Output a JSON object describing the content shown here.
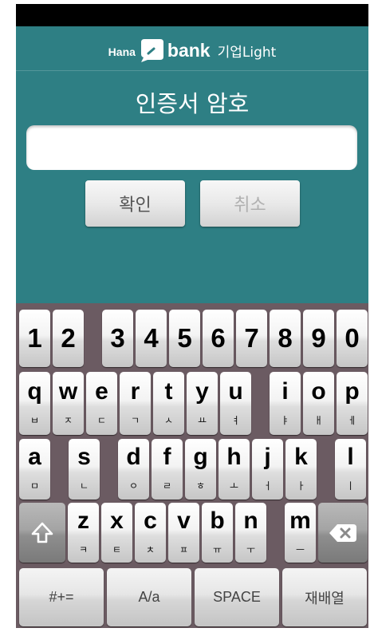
{
  "header": {
    "brand_left": "Hana",
    "logo_icon": "hana-logo-icon",
    "brand_main": "bank",
    "brand_suffix": "기업Light"
  },
  "title": "인증서 암호",
  "password_input": {
    "value": ""
  },
  "buttons": {
    "confirm": "확인",
    "cancel": "취소"
  },
  "keyboard": {
    "numbers": [
      "1",
      "2",
      "3",
      "4",
      "5",
      "6",
      "7",
      "8",
      "9",
      "0"
    ],
    "row_qwerty": [
      {
        "key": "q",
        "sub": "ㅂ"
      },
      {
        "key": "w",
        "sub": "ㅈ"
      },
      {
        "key": "e",
        "sub": "ㄷ"
      },
      {
        "key": "r",
        "sub": "ㄱ"
      },
      {
        "key": "t",
        "sub": "ㅅ"
      },
      {
        "key": "y",
        "sub": "ㅛ"
      },
      {
        "key": "u",
        "sub": "ㅕ"
      },
      {
        "key": "i",
        "sub": "ㅑ"
      },
      {
        "key": "o",
        "sub": "ㅐ"
      },
      {
        "key": "p",
        "sub": "ㅔ"
      }
    ],
    "row_asdf": [
      {
        "key": "a",
        "sub": "ㅁ"
      },
      {
        "key": "s",
        "sub": "ㄴ"
      },
      {
        "key": "d",
        "sub": "ㅇ"
      },
      {
        "key": "f",
        "sub": "ㄹ"
      },
      {
        "key": "g",
        "sub": "ㅎ"
      },
      {
        "key": "h",
        "sub": "ㅗ"
      },
      {
        "key": "j",
        "sub": "ㅓ"
      },
      {
        "key": "k",
        "sub": "ㅏ"
      },
      {
        "key": "l",
        "sub": "ㅣ"
      }
    ],
    "row_zxcv": [
      {
        "key": "z",
        "sub": "ㅋ"
      },
      {
        "key": "x",
        "sub": "ㅌ"
      },
      {
        "key": "c",
        "sub": "ㅊ"
      },
      {
        "key": "v",
        "sub": "ㅍ"
      },
      {
        "key": "b",
        "sub": "ㅠ"
      },
      {
        "key": "n",
        "sub": "ㅜ"
      },
      {
        "key": "m",
        "sub": "ㅡ"
      }
    ],
    "shift_icon": "shift-arrow-icon",
    "backspace_icon": "backspace-icon",
    "function_keys": [
      "#+=",
      "A/a",
      "SPACE",
      "재배열"
    ]
  },
  "colors": {
    "header_bg": "#2e7f84",
    "keyboard_bg": "#6b5b62",
    "status_bar": "#000000"
  }
}
